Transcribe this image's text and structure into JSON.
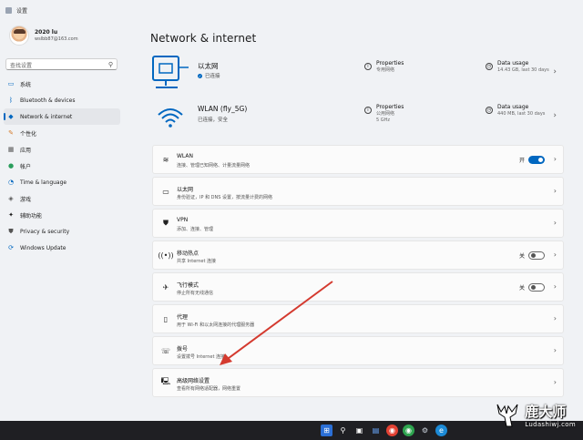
{
  "window": {
    "title": "设置"
  },
  "user": {
    "name": "2020 lu",
    "email": "wslbb87@163.com"
  },
  "search": {
    "placeholder": "查找设置",
    "icon": "search-icon"
  },
  "nav": [
    {
      "label": "系统",
      "icon": "monitor-icon",
      "color": "#0067c0"
    },
    {
      "label": "Bluetooth & devices",
      "icon": "bluetooth-icon",
      "color": "#0067c0"
    },
    {
      "label": "Network & internet",
      "icon": "wifi-icon",
      "color": "#0067c0",
      "active": true
    },
    {
      "label": "个性化",
      "icon": "brush-icon",
      "color": "#d47b2a"
    },
    {
      "label": "应用",
      "icon": "apps-icon",
      "color": "#555555"
    },
    {
      "label": "帐户",
      "icon": "person-icon",
      "color": "#2a9d5c"
    },
    {
      "label": "Time & language",
      "icon": "globe-clock-icon",
      "color": "#0067c0"
    },
    {
      "label": "游戏",
      "icon": "gamepad-icon",
      "color": "#555555"
    },
    {
      "label": "辅助功能",
      "icon": "accessibility-icon",
      "color": "#1b1b1b"
    },
    {
      "label": "Privacy & security",
      "icon": "shield-icon",
      "color": "#555555"
    },
    {
      "label": "Windows Update",
      "icon": "update-icon",
      "color": "#0067c0"
    }
  ],
  "page": {
    "title": "Network & internet"
  },
  "connections": [
    {
      "name": "以太网",
      "status": "已连接",
      "props_title": "Properties",
      "props_sub": "专用网络",
      "props_sub2": "",
      "usage_title": "Data usage",
      "usage_sub": "14.43 GB, last 30 days"
    },
    {
      "name": "WLAN (fly_5G)",
      "status": "已连接，安全",
      "props_title": "Properties",
      "props_sub": "公用网络",
      "props_sub2": "5 GHz",
      "usage_title": "Data usage",
      "usage_sub": "440 MB, last 30 days"
    }
  ],
  "rows": [
    {
      "title": "WLAN",
      "sub": "连接、管理已知网络、计量流量网络",
      "icon": "wifi-icon",
      "toggle": "开",
      "on": true
    },
    {
      "title": "以太网",
      "sub": "身份验证，IP 和 DNS 设置，按流量计费的网络",
      "icon": "ethernet-icon"
    },
    {
      "title": "VPN",
      "sub": "添加、连接、管理",
      "icon": "vpn-shield-icon"
    },
    {
      "title": "移动热点",
      "sub": "共享 Internet 连接",
      "icon": "hotspot-icon",
      "toggle": "关",
      "on": false
    },
    {
      "title": "飞行模式",
      "sub": "停止所有无线通信",
      "icon": "airplane-icon",
      "toggle": "关",
      "on": false
    },
    {
      "title": "代理",
      "sub": "用于 Wi-Fi 和以太网连接的代理服务器",
      "icon": "proxy-icon"
    },
    {
      "title": "拨号",
      "sub": "设置拨号 Internet 连接",
      "icon": "dialup-icon"
    },
    {
      "title": "高级网络设置",
      "sub": "查看所有网络适配器，网络重置",
      "icon": "network-pc-icon"
    }
  ],
  "colors": {
    "accent": "#0067c0",
    "arrow": "#d43a2f"
  },
  "taskbar": {
    "icons": [
      "windows-icon",
      "search-icon",
      "taskview-icon",
      "widgets-icon",
      "chrome-icon",
      "chrome-icon",
      "settings-icon",
      "edge-icon"
    ]
  },
  "watermark": {
    "title": "鹿大师",
    "url": "Ludashiwj.com"
  }
}
